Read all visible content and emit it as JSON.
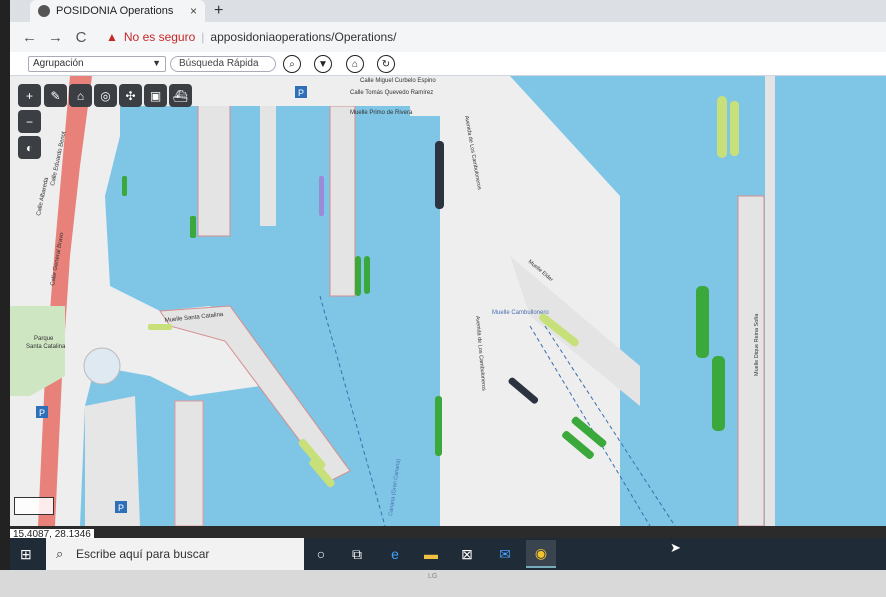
{
  "browser": {
    "tab_title": "POSIDONIA Operations",
    "new_tab_label": "+",
    "close_label": "×",
    "nav": {
      "back": "←",
      "forward": "→",
      "reload": "C"
    },
    "security_label": "No es seguro",
    "url": "apposidoniaoperations/Operations/"
  },
  "app_toolbar": {
    "grouping_value": "Agrupación",
    "quick_search_placeholder": "Búsqueda Rápida",
    "buttons": [
      "search-icon",
      "filter-icon",
      "home-icon",
      "refresh-icon"
    ]
  },
  "map": {
    "street_labels": {
      "calle_curbelo": "Calle Miguel Curbelo Espino",
      "calle_quevedo": "Calle Tomás Quevedo Ramírez",
      "muelle_primo": "Muelle Primo de Rivera",
      "av_cambuloneros_1": "Avenida de Los Cambuloneros",
      "av_cambuloneros_2": "Avenida de Los Cambuloneros",
      "muelle_elder": "Muelle Elder",
      "muelle_cambulloneros": "Muelle Cambullonero",
      "muelle_santa_catalina": "Muelle Santa Catalina",
      "muelle_reina_sofia": "Muelle Dique Reina Sofía",
      "parque": "Parque",
      "santa_catalina": "Santa Catalina",
      "calle_general_bravo": "Calle General Bravo",
      "calle_albareda": "Calle Albareda",
      "calle_eduardo_benot": "Calle Eduardo Benot",
      "gran_canaria": "Canaria (Gran Canaria)"
    },
    "parking_symbol": "P",
    "colors": {
      "water": "#7fc6e6",
      "land": "#eeeeee",
      "pier": "#e4e4e4",
      "road_red": "#e8817a",
      "vessel_green": "#3aa83a",
      "vessel_lime": "#c8e07a",
      "vessel_dark": "#2b3240",
      "vessel_purple": "#9a8ad8"
    },
    "coordinates": "15.4087, 28.1346"
  },
  "taskbar": {
    "search_placeholder": "Escribe aquí para buscar",
    "apps": [
      "cortana-icon",
      "task-view-icon",
      "edge-icon",
      "explorer-icon",
      "store-icon",
      "mail-icon",
      "chrome-icon"
    ]
  },
  "bezel": {
    "logo": "LG"
  }
}
